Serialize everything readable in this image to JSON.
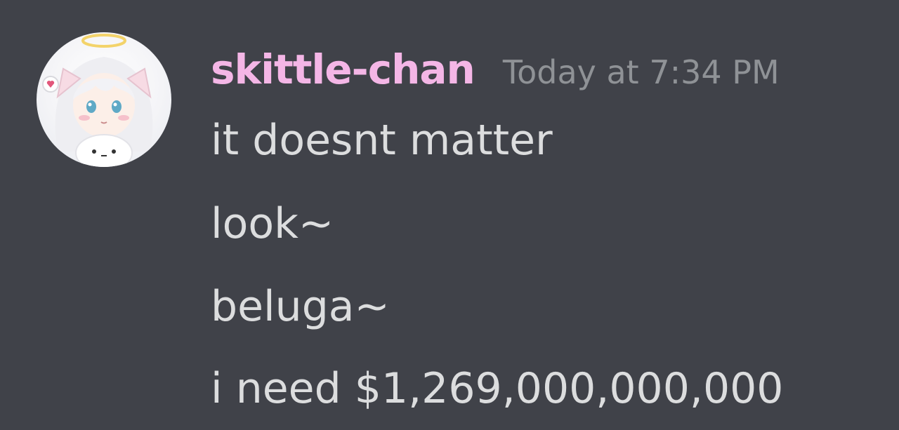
{
  "message": {
    "username": "skittle-chan",
    "timestamp": "Today at 7:34 PM",
    "lines": [
      "it doesnt matter",
      "look~",
      "beluga~",
      "i need $1,269,000,000,000"
    ]
  },
  "avatar": {
    "icon": "anime-girl-avatar"
  },
  "colors": {
    "background": "#404249",
    "username": "#f4b6e6",
    "timestamp": "#8f9296",
    "text": "#dcddde"
  }
}
